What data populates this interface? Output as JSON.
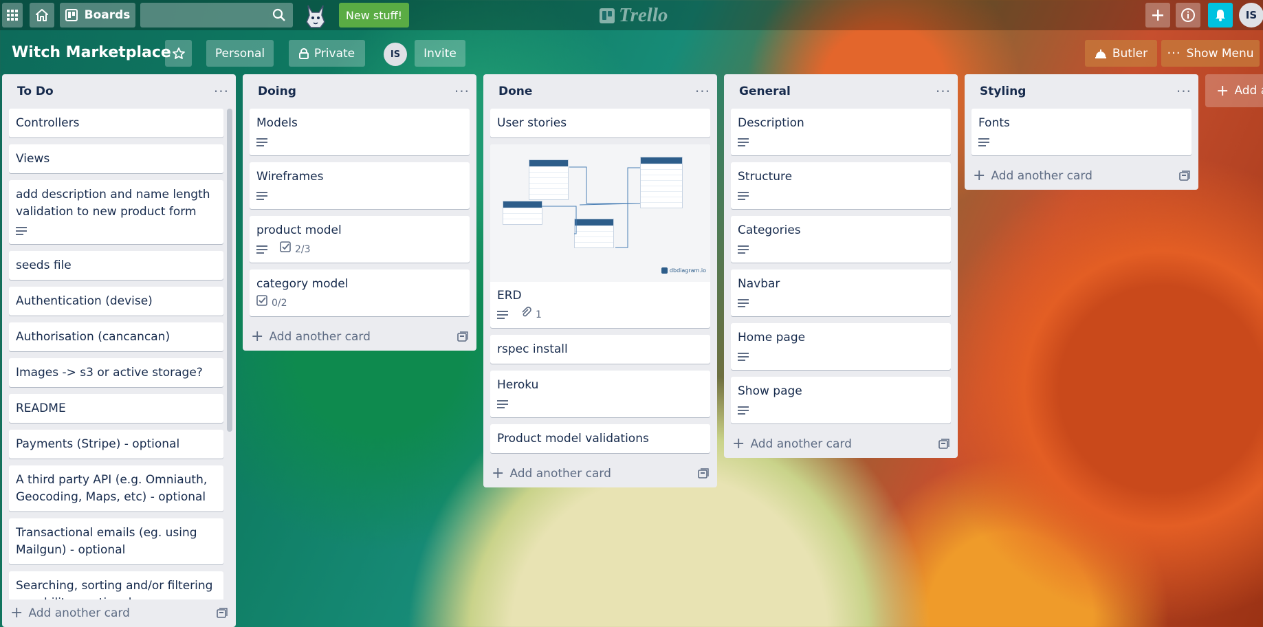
{
  "header": {
    "boards_label": "Boards",
    "search_placeholder": "",
    "new_stuff_label": "New stuff!",
    "logo_text": "Trello",
    "avatar_initials": "IS"
  },
  "board": {
    "title": "Witch Marketplace",
    "team_label": "Personal",
    "visibility_label": "Private",
    "member_initials": "IS",
    "invite_label": "Invite",
    "butler_label": "Butler",
    "show_menu_label": "Show Menu",
    "add_list_label": "Add a"
  },
  "lists": [
    {
      "title": "To Do",
      "add_label": "Add another card",
      "cards": [
        {
          "title": "Controllers"
        },
        {
          "title": "Views"
        },
        {
          "title": "add description and name length validation to new product form",
          "desc": true
        },
        {
          "title": "seeds file"
        },
        {
          "title": "Authentication (devise)"
        },
        {
          "title": "Authorisation (cancancan)"
        },
        {
          "title": "Images -> s3 or active storage?"
        },
        {
          "title": "README"
        },
        {
          "title": "Payments (Stripe) - optional"
        },
        {
          "title": "A third party API (e.g. Omniauth, Geocoding, Maps, etc) - optional"
        },
        {
          "title": "Transactional emails (eg. using Mailgun) - optional"
        },
        {
          "title": "Searching, sorting and/or filtering capability - optional"
        }
      ]
    },
    {
      "title": "Doing",
      "add_label": "Add another card",
      "cards": [
        {
          "title": "Models",
          "desc": true
        },
        {
          "title": "Wireframes",
          "desc": true
        },
        {
          "title": "product model",
          "desc": true,
          "checklist": "2/3"
        },
        {
          "title": "category model",
          "checklist": "0/2"
        }
      ]
    },
    {
      "title": "Done",
      "add_label": "Add another card",
      "cards": [
        {
          "title": "User stories"
        },
        {
          "title": "ERD",
          "desc": true,
          "attachments": "1",
          "cover": true
        },
        {
          "title": "rspec install"
        },
        {
          "title": "Heroku",
          "desc": true
        },
        {
          "title": "Product model validations"
        }
      ]
    },
    {
      "title": "General",
      "add_label": "Add another card",
      "cards": [
        {
          "title": "Description",
          "desc": true
        },
        {
          "title": "Structure",
          "desc": true
        },
        {
          "title": "Categories",
          "desc": true
        },
        {
          "title": "Navbar",
          "desc": true
        },
        {
          "title": "Home page",
          "desc": true
        },
        {
          "title": "Show page",
          "desc": true
        }
      ]
    },
    {
      "title": "Styling",
      "add_label": "Add another card",
      "cards": [
        {
          "title": "Fonts",
          "desc": true
        }
      ]
    }
  ],
  "erd": {
    "watermark": "dbdiagram.io"
  },
  "colors": {
    "header_bg": "rgba(0,0,0,0.25)",
    "new_stuff_bg": "#5aac44",
    "notification_bg": "#00c2e0",
    "list_bg": "#ebecf0",
    "butler_bg": "#c5763a"
  }
}
